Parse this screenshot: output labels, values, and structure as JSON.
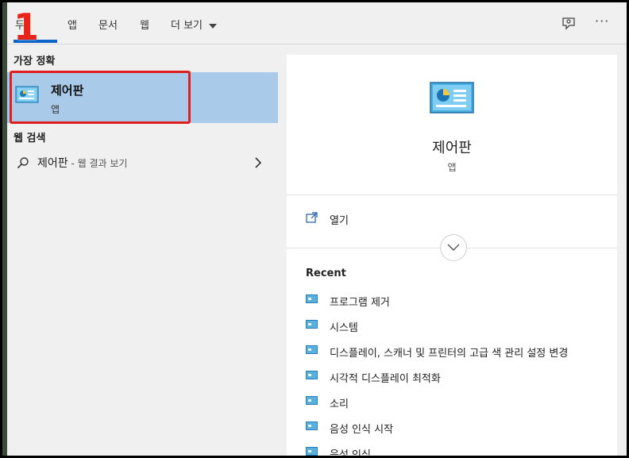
{
  "annotation": {
    "step_number": "1"
  },
  "tabs": [
    {
      "label": "두",
      "active": true
    },
    {
      "label": "앱"
    },
    {
      "label": "문서"
    },
    {
      "label": "웹"
    },
    {
      "label": "더 보기"
    }
  ],
  "left": {
    "best_match_heading": "가장 정확",
    "best_match": {
      "title": "제어판",
      "subtitle": "앱"
    },
    "web_heading": "웹 검색",
    "web_result": {
      "query": "제어판",
      "suffix": " - 웹 결과 보기"
    }
  },
  "preview": {
    "title": "제어판",
    "subtitle": "앱",
    "open_label": "열기",
    "recent_heading": "Recent",
    "recent_items": [
      "프로그램 제거",
      "시스템",
      "디스플레이, 스캐너 및 프린터의 고급 색 관리 설정 변경",
      "시각적 디스플레이 최적화",
      "소리",
      "음성 인식 시작",
      "음성 인식"
    ]
  },
  "colors": {
    "accent": "#0a63c9",
    "selection": "#a9cae8",
    "highlight_box": "#e01e1e"
  },
  "icons": [
    "control-panel-icon",
    "search-icon",
    "chevron-right-icon",
    "open-icon",
    "chevron-down-icon",
    "feedback-icon",
    "more-icon",
    "dropdown-caret-icon"
  ]
}
